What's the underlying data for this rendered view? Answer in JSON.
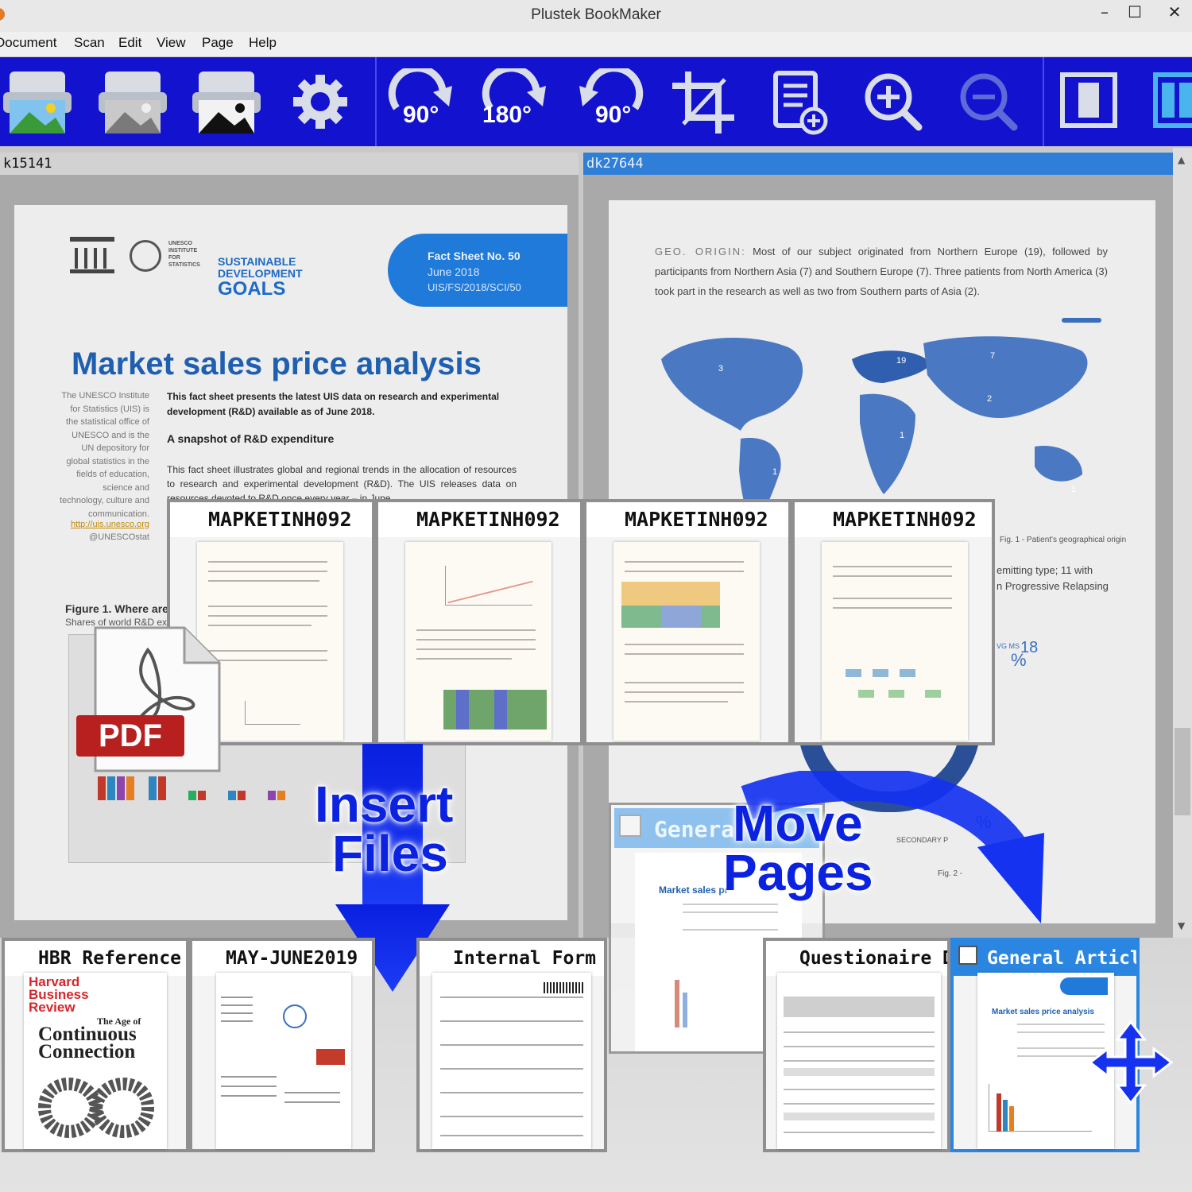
{
  "window": {
    "title": "Plustek BookMaker",
    "minimize": "–",
    "maximize": "☐",
    "close": "✕"
  },
  "menu": [
    "Document",
    "Scan",
    "Edit",
    "View",
    "Page",
    "Help"
  ],
  "toolbar": {
    "rotate_cw_label": "90°",
    "rotate_180_label": "180°",
    "rotate_ccw_label": "90°",
    "icons": [
      "scan-color-icon",
      "scan-gray-icon",
      "scan-bw-icon",
      "settings-gear-icon",
      "rotate-90-cw-icon",
      "rotate-180-icon",
      "rotate-90-ccw-icon",
      "crop-icon",
      "add-page-icon",
      "zoom-in-icon",
      "zoom-out-icon",
      "single-page-view-icon",
      "double-page-view-icon"
    ]
  },
  "left_panel": {
    "id": "k15141",
    "doc": {
      "fact_sheet": [
        "Fact Sheet No. 50",
        "June 2018",
        "UIS/FS/2018/SCI/50"
      ],
      "logo_text": "UNESCO INSTITUTE FOR STATISTICS",
      "sdg_text": [
        "SUSTAINABLE",
        "DEVELOPMENT",
        "GOALS"
      ],
      "title": "Market sales price analysis",
      "sidebar": "The UNESCO Institute for Statistics (UIS) is the statistical office of UNESCO and is the UN depository for global statistics in the fields of education, science and technology, culture and communication.",
      "link": "http://uis.unesco.org",
      "handle": "@UNESCOstat",
      "intro": "This fact sheet presents the latest UIS data on research and experimental development (R&D) available as of June 2018.",
      "section": "A snapshot of R&D expenditure",
      "body": "This fact sheet illustrates global and regional trends in the allocation of resources to research and experimental development (R&D). The UIS releases data on resources devoted to R&D once every year – in June.",
      "figure_title": "Figure 1. Where are",
      "figure_sub": "Shares of world R&D ex"
    }
  },
  "right_panel": {
    "id": "dk27644",
    "doc": {
      "geo_label": "GEO. ORIGIN:",
      "geo_text": "Most of our subject originated from Northern Europe (19), followed by participants from Northern Asia (7) and Southern Europe (7). Three patients from North America (3) took part in the research as well as two from Southern parts of Asia (2).",
      "map_numbers": [
        "3",
        "19",
        "7",
        "7",
        "2",
        "1",
        "1",
        "1"
      ],
      "fig1": "Fig. 1 - Patient's geographical origin",
      "remit_1": "emitting type; 11 with",
      "remit_2": "n Progressive Relapsing",
      "stat_small": "VG MS",
      "stat_pct": "%",
      "stat_18": "18",
      "pct2": "%",
      "secondary": "SECONDARY P",
      "fig2": "Fig. 2 -"
    }
  },
  "middle_thumbs": [
    "MAPKETINH092",
    "MAPKETINH092",
    "MAPKETINH092",
    "MAPKETINH092"
  ],
  "overlay": {
    "pdf_label": "PDF",
    "insert_1": "Insert",
    "insert_2": "Files",
    "move_1": "Move",
    "move_2": "Pages",
    "ghost_label": "Genera",
    "ghost_title": "Market sales pr"
  },
  "bottom_thumbs": [
    {
      "label": "HBR Reference"
    },
    {
      "label": "MAY-JUNE2019"
    },
    {
      "label": "Internal Form Co"
    },
    {
      "label": "Questionaire Da"
    },
    {
      "label": "General Article f"
    }
  ],
  "hbr": {
    "brand_1": "Harvard",
    "brand_2": "Business",
    "brand_3": "Review",
    "headline_1": "The Age of",
    "headline_2": "Continuous",
    "headline_3": "Connection"
  },
  "general_page_title": "Market sales price analysis",
  "colors": {
    "toolbar": "#1212cf",
    "accent": "#1f7ad9",
    "title_blue": "#1f5fb0",
    "pdf_red": "#b7201e",
    "selected": "#2a86e0"
  }
}
